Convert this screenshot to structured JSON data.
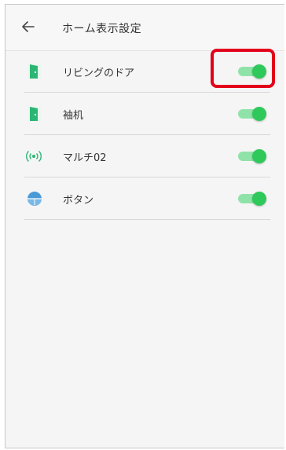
{
  "header": {
    "title": "ホーム表示設定"
  },
  "items": [
    {
      "label": "リビングのドア",
      "icon": "door-icon",
      "enabled": true
    },
    {
      "label": "袖机",
      "icon": "door-icon",
      "enabled": true
    },
    {
      "label": "マルチ02",
      "icon": "wireless-signal-icon",
      "enabled": true
    },
    {
      "label": "ボタン",
      "icon": "round-button-icon",
      "enabled": true
    }
  ],
  "colors": {
    "toggle_on": "#2fc85a",
    "toggle_track": "#90e3a8",
    "icon_green": "#2bb673",
    "icon_blue": "#4a9ad8",
    "highlight": "#e3001b"
  }
}
